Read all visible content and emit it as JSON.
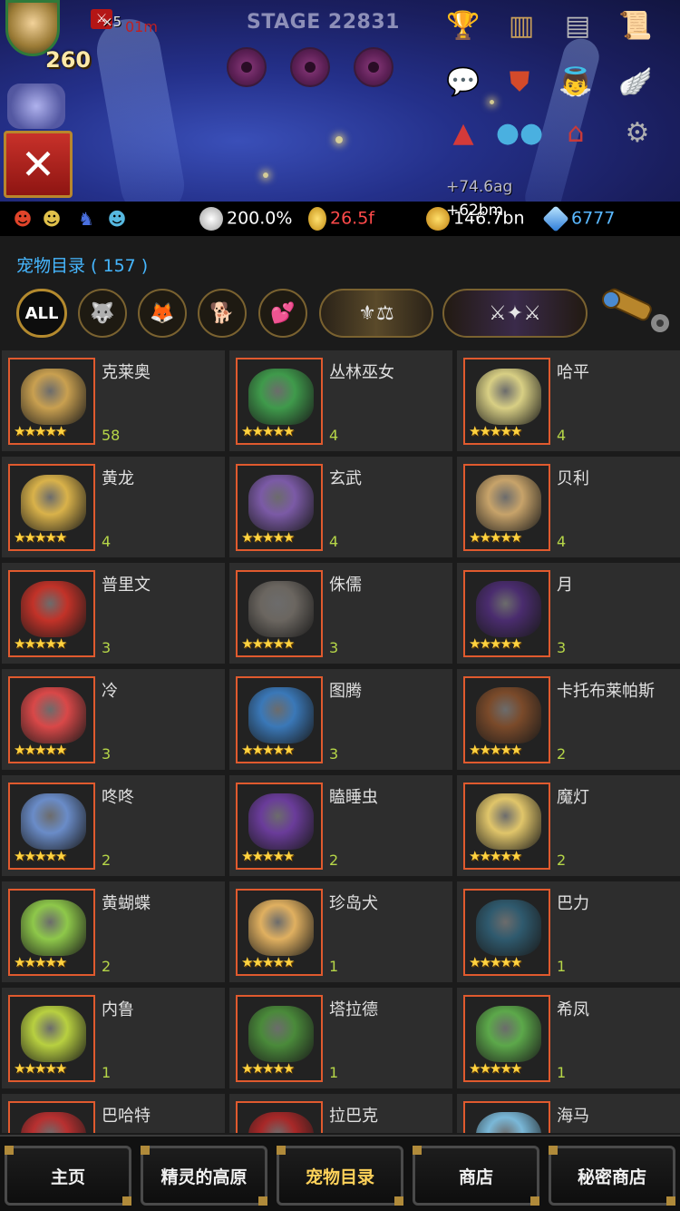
{
  "hud": {
    "hero_level": "260",
    "attack_multiplier": "×5",
    "timer": "01m",
    "stage": "STAGE 22831",
    "floating_reward_1": "+74.6ag",
    "floating_reward_2": "+62bm",
    "icons": [
      "trophy-icon",
      "ranking-icon",
      "quest-book-icon",
      "scroll-icon",
      "chat-icon",
      "event-banner-icon",
      "angel-icon",
      "wings-icon",
      "warning-icon",
      "party-icon",
      "house-icon",
      "gear-icon"
    ]
  },
  "resources": {
    "party_icons": [
      "red-hero-icon",
      "green-hero-icon",
      "blue-knight-icon",
      "blue-robot-icon"
    ],
    "wing_bonus": "200.0%",
    "medal": "26.5f",
    "gold": "146.7bn",
    "gems": "6777"
  },
  "catalog": {
    "title": "宠物目录 ( 157 )",
    "filter_all": "ALL",
    "filters": [
      "wolf-filter-icon",
      "fox-filter-icon",
      "dog-filter-icon",
      "love-filter-icon",
      "legend-group-icon",
      "dark-group-icon",
      "telescope-icon"
    ]
  },
  "pets": [
    {
      "name": "克莱奥",
      "count": "58",
      "stars": "★★★★★",
      "color": "#c9a050"
    },
    {
      "name": "丛林巫女",
      "count": "4",
      "stars": "★★★★★",
      "color": "#3f9a4b"
    },
    {
      "name": "哈平",
      "count": "4",
      "stars": "★★★★★",
      "color": "#d8cf84"
    },
    {
      "name": "黄龙",
      "count": "4",
      "stars": "★★★★★",
      "color": "#d9b24a"
    },
    {
      "name": "玄武",
      "count": "4",
      "stars": "★★★★★",
      "color": "#7b5aa6"
    },
    {
      "name": "贝利",
      "count": "4",
      "stars": "★★★★★",
      "color": "#c7a36a"
    },
    {
      "name": "普里文",
      "count": "3",
      "stars": "★★★★★",
      "color": "#c23228"
    },
    {
      "name": "侏儒",
      "count": "3",
      "stars": "★★★★★",
      "color": "#6b6660"
    },
    {
      "name": "月",
      "count": "3",
      "stars": "★★★★★",
      "color": "#4a2c6e"
    },
    {
      "name": "冷",
      "count": "3",
      "stars": "★★★★★",
      "color": "#d94848"
    },
    {
      "name": "图腾",
      "count": "3",
      "stars": "★★★★★",
      "color": "#3a78b8"
    },
    {
      "name": "卡托布莱帕斯",
      "count": "2",
      "stars": "★★★★★",
      "color": "#7a4a2a"
    },
    {
      "name": "咚咚",
      "count": "2",
      "stars": "★★★★★",
      "color": "#6a8cc8"
    },
    {
      "name": "瞌睡虫",
      "count": "2",
      "stars": "★★★★★",
      "color": "#6a3c9a"
    },
    {
      "name": "魔灯",
      "count": "2",
      "stars": "★★★★★",
      "color": "#e0c56a"
    },
    {
      "name": "黄蝴蝶",
      "count": "2",
      "stars": "★★★★★",
      "color": "#8ec84a"
    },
    {
      "name": "珍岛犬",
      "count": "1",
      "stars": "★★★★★",
      "color": "#e0b060"
    },
    {
      "name": "巴力",
      "count": "1",
      "stars": "★★★★★",
      "color": "#2f5a6e"
    },
    {
      "name": "内鲁",
      "count": "1",
      "stars": "★★★★★",
      "color": "#b8d040"
    },
    {
      "name": "塔拉德",
      "count": "1",
      "stars": "★★★★★",
      "color": "#4a8a3a"
    },
    {
      "name": "希凤",
      "count": "1",
      "stars": "★★★★★",
      "color": "#5ca84a"
    },
    {
      "name": "巴哈特",
      "count": "",
      "stars": "",
      "color": "#b83030"
    },
    {
      "name": "拉巴克",
      "count": "",
      "stars": "",
      "color": "#a82828"
    },
    {
      "name": "海马",
      "count": "",
      "stars": "",
      "color": "#7ab8d8"
    }
  ],
  "nav": [
    {
      "label": "主页",
      "active": false
    },
    {
      "label": "精灵的高原",
      "active": false
    },
    {
      "label": "宠物目录",
      "active": true
    },
    {
      "label": "商店",
      "active": false
    },
    {
      "label": "秘密商店",
      "active": false
    }
  ]
}
